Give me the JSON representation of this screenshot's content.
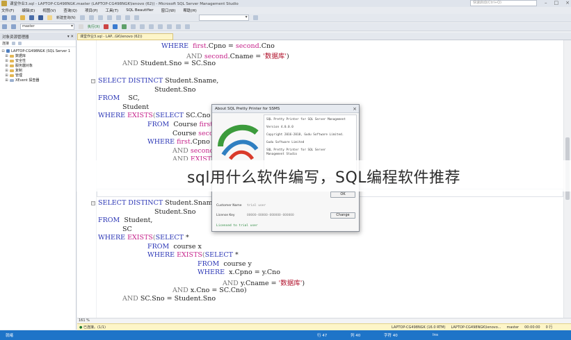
{
  "window": {
    "title": "课堂作业3.sql - LAPTOP-CG498NGK.master (LAPTOP-CG498NGK\\lenovo (62)) - Microsoft SQL Server Management Studio",
    "quick_launch_placeholder": "快速启动(Ctrl+Q)"
  },
  "menu": [
    "文件(F)",
    "编辑(E)",
    "视图(V)",
    "查询(Q)",
    "项目(P)",
    "工具(T)",
    "SQL Beautifier",
    "窗口(W)",
    "帮助(H)"
  ],
  "toolbar": {
    "new_query": "新建查询(N)",
    "database": "master",
    "execute": "执行(X)"
  },
  "explorer": {
    "title": "对象资源管理器",
    "connect": "连接",
    "server": "LAPTOP-CG498NGK (SQL Server 1",
    "nodes": [
      "数据库",
      "安全性",
      "服务器对象",
      "复制",
      "管理",
      "XEvent 探查器"
    ]
  },
  "tab": {
    "label": "课堂作业3.sql - LAP...GK\\lenovo (62))"
  },
  "code": {
    "l1": {
      "kw": "WHERE",
      "a": "first",
      "b": ".Cpno = ",
      "c": "second",
      "d": ".Cno"
    },
    "l2": {
      "kw": "AND",
      "a": "second",
      "b": ".Cname = ",
      "s": "'数据库'",
      "e": ")"
    },
    "l3": {
      "kw": "AND",
      "rest": "Student.Sno = SC.Sno"
    },
    "q2_1": {
      "kw": "SELECT DISTINCT",
      "rest": "Student.Sname,"
    },
    "q2_2": {
      "rest": "Student.Sno"
    },
    "q2_3": {
      "kw": "FROM",
      "rest": "SC,"
    },
    "q2_4": {
      "rest": "Student"
    },
    "q2_5": {
      "kw": "WHERE",
      "fn": "EXISTS",
      "p": "(",
      "kw2": "SELECT",
      "rest": " SC.Cno"
    },
    "q2_6": {
      "kw": "FROM",
      "rest": "Course ",
      "a": "first"
    },
    "q2_7": {
      "rest": "Course ",
      "a": "seco"
    },
    "q2_8": {
      "kw": "WHERE",
      "a": "first",
      "rest": ".Cpno"
    },
    "q2_9": {
      "kw": "AND",
      "a": "second",
      "rest": "."
    },
    "q2_10": {
      "kw": "AND",
      "fn": "EXISTS"
    },
    "q3_1": {
      "kw": "SELECT DISTINCT",
      "rest": "Student.Sname,"
    },
    "q3_2": {
      "rest": "Student.Sno"
    },
    "q3_3": {
      "kw": "FROM",
      "rest": "Student,"
    },
    "q3_4": {
      "rest": "SC"
    },
    "q3_5": {
      "kw": "WHERE",
      "fn": "EXISTS",
      "p": "(",
      "kw2": "SELECT",
      "rest": " *"
    },
    "q3_6": {
      "kw": "FROM",
      "rest": "course x"
    },
    "q3_7": {
      "kw": "WHERE",
      "fn": "EXISTS",
      "p": "(",
      "kw2": "SELECT",
      "rest": " *"
    },
    "q3_8": {
      "kw": "FROM",
      "rest": "course y"
    },
    "q3_9": {
      "kw": "WHERE",
      "rest": "x.Cpno = y.Cno"
    },
    "q3_10": {
      "kw": "AND",
      "rest": "y.Cname = ",
      "s": "'数据库'",
      "e": ")"
    },
    "q3_11": {
      "kw": "AND",
      "rest": "x.Cno = SC.Cno)"
    },
    "q3_12": {
      "kw": "AND",
      "rest": "SC.Sno = Student.Sno"
    }
  },
  "dialog": {
    "title": "About SQL Pretty Printer for SSMS",
    "about_lines": [
      "SQL Pretty Printer for SQL Server Management",
      "Version 4.0.0.0",
      "Copyright 2016-2018, Gudu Software Limited.",
      "Gudu Software Limited",
      "SQL Pretty Printer for SQL Server",
      "Management Studio"
    ],
    "ok_label": "OK",
    "customer_label": "Customer Name",
    "customer_value": "trial user",
    "license_label": "License Key",
    "license_value": "00000-00000-000000-000000",
    "change_label": "Change",
    "licensed_text": "Licensed to trial user"
  },
  "overlay": {
    "text": "sql用什么软件编写，SQL编程软件推荐"
  },
  "editor_status": {
    "zoom": "161 %"
  },
  "query_status": {
    "ok": "已连接。(1/1)",
    "server": "LAPTOP-CG498NGK (16.0 RTM)",
    "user": "LAPTOP-CG498NGK\\lenovo...",
    "db": "master",
    "time": "00:00:00",
    "rows": "0 行"
  },
  "statusbar": {
    "ready": "就绪",
    "line": "行 47",
    "col": "列 40",
    "char": "字符 40",
    "ins": "Ins"
  },
  "colors": {
    "keyword": "#2a35b5",
    "function": "#c6248b",
    "string": "#b0102a",
    "statusbar": "#1e74c8"
  }
}
